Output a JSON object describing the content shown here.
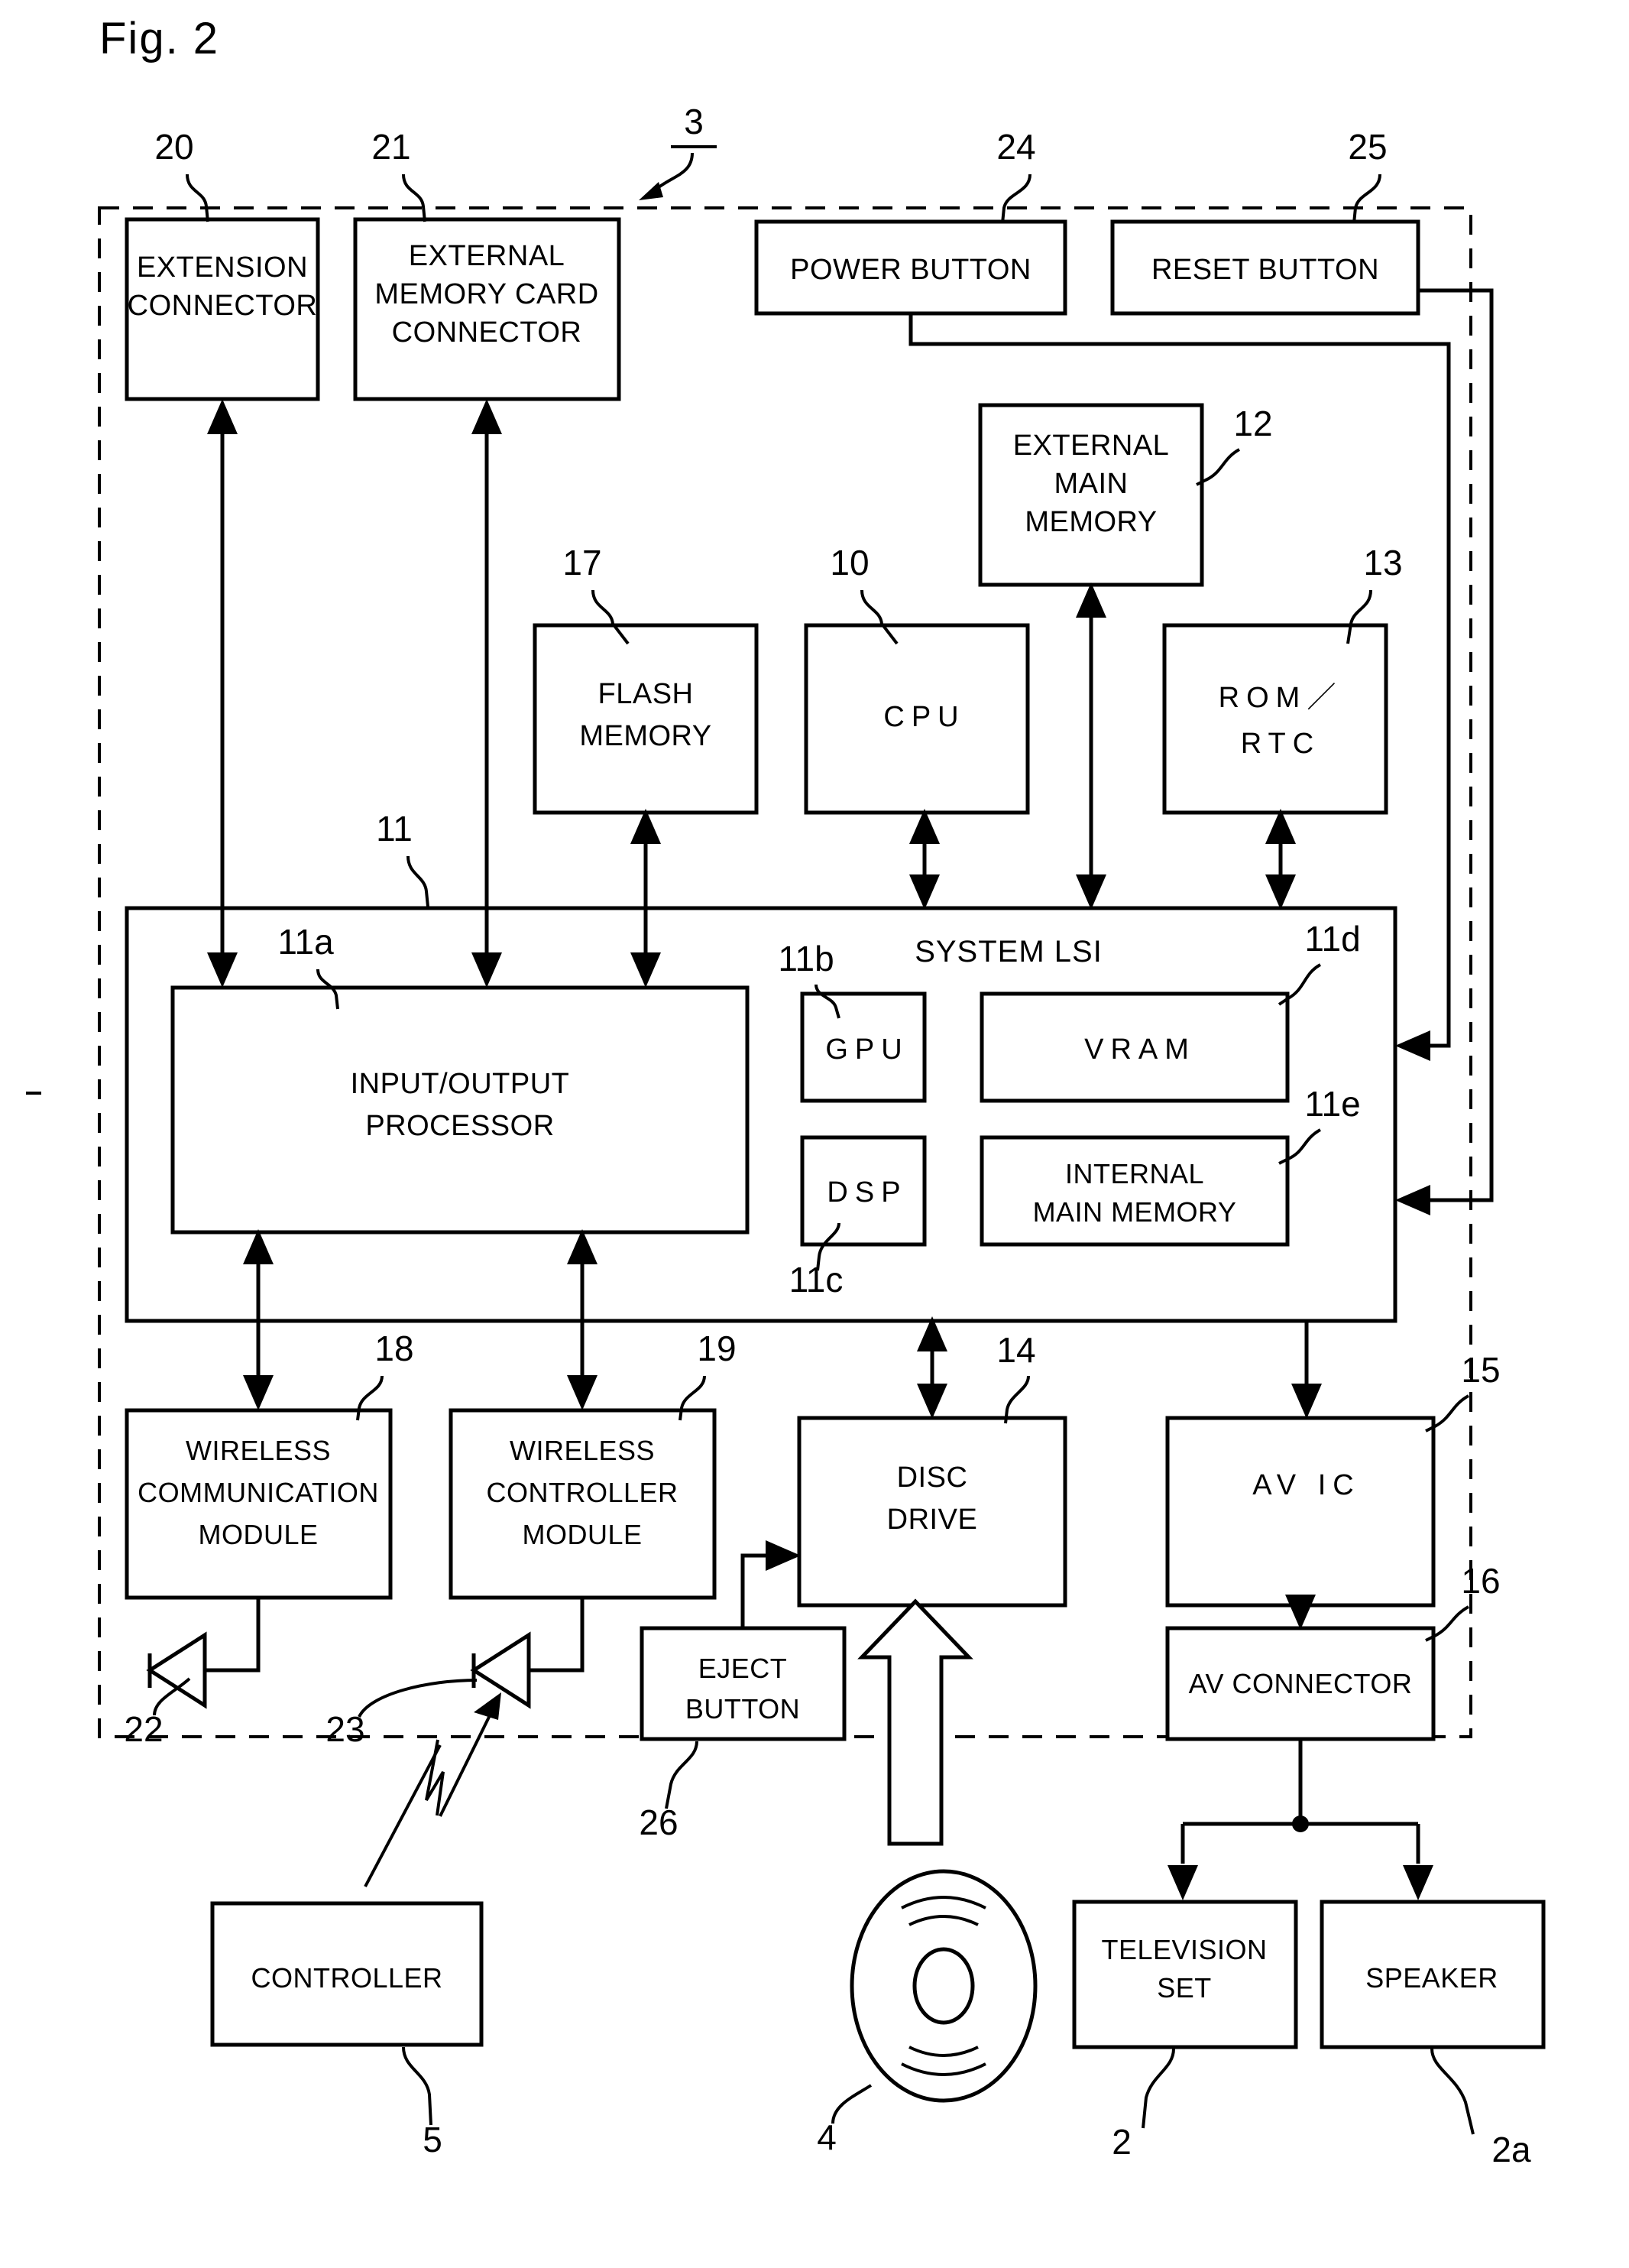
{
  "figure": {
    "title": "Fig. 2",
    "system_ref": "3",
    "lsi_title": "SYSTEM LSI"
  },
  "blocks": {
    "extension_connector": {
      "lines": [
        "EXTENSION",
        "CONNECTOR"
      ],
      "ref": "20"
    },
    "external_memory_card_connector": {
      "lines": [
        "EXTERNAL",
        "MEMORY CARD",
        "CONNECTOR"
      ],
      "ref": "21"
    },
    "power_button": {
      "lines": [
        "POWER BUTTON"
      ],
      "ref": "24"
    },
    "reset_button": {
      "lines": [
        "RESET BUTTON"
      ],
      "ref": "25"
    },
    "external_main_memory": {
      "lines": [
        "EXTERNAL",
        "MAIN",
        "MEMORY"
      ],
      "ref": "12"
    },
    "flash_memory": {
      "lines": [
        "FLASH",
        "MEMORY"
      ],
      "ref": "17"
    },
    "cpu": {
      "lines": [
        "CPU"
      ],
      "ref": "10"
    },
    "rom_rtc": {
      "lines": [
        "ROM／",
        "RTC"
      ],
      "ref": "13"
    },
    "system_lsi": {
      "lines": [
        "SYSTEM LSI"
      ],
      "ref": "11"
    },
    "input_output_processor": {
      "lines": [
        "INPUT/OUTPUT",
        "PROCESSOR"
      ],
      "ref": "11a"
    },
    "gpu": {
      "lines": [
        "GPU"
      ],
      "ref": "11b"
    },
    "dsp": {
      "lines": [
        "DSP"
      ],
      "ref": "11c"
    },
    "vram": {
      "lines": [
        "VRAM"
      ],
      "ref": "11d"
    },
    "internal_main_memory": {
      "lines": [
        "INTERNAL",
        "MAIN MEMORY"
      ],
      "ref": "11e"
    },
    "wireless_communication_module": {
      "lines": [
        "WIRELESS",
        "COMMUNICATION",
        "MODULE"
      ],
      "ref": "18"
    },
    "wireless_controller_module": {
      "lines": [
        "WIRELESS",
        "CONTROLLER",
        "MODULE"
      ],
      "ref": "19"
    },
    "disc_drive": {
      "lines": [
        "DISC",
        "DRIVE"
      ],
      "ref": "14"
    },
    "av_ic": {
      "lines": [
        "AV IC"
      ],
      "ref": "15"
    },
    "av_connector": {
      "lines": [
        "AV CONNECTOR"
      ],
      "ref": "16"
    },
    "eject_button": {
      "lines": [
        "EJECT",
        "BUTTON"
      ],
      "ref": "26"
    },
    "controller": {
      "lines": [
        "CONTROLLER"
      ],
      "ref": "5"
    },
    "television_set": {
      "lines": [
        "TELEVISION",
        "SET"
      ],
      "ref": "2"
    },
    "speaker": {
      "lines": [
        "SPEAKER"
      ],
      "ref": "2a"
    },
    "antenna_communication": {
      "lines": [],
      "ref": "22"
    },
    "antenna_controller": {
      "lines": [],
      "ref": "23"
    },
    "optical_disc": {
      "lines": [],
      "ref": "4"
    }
  }
}
